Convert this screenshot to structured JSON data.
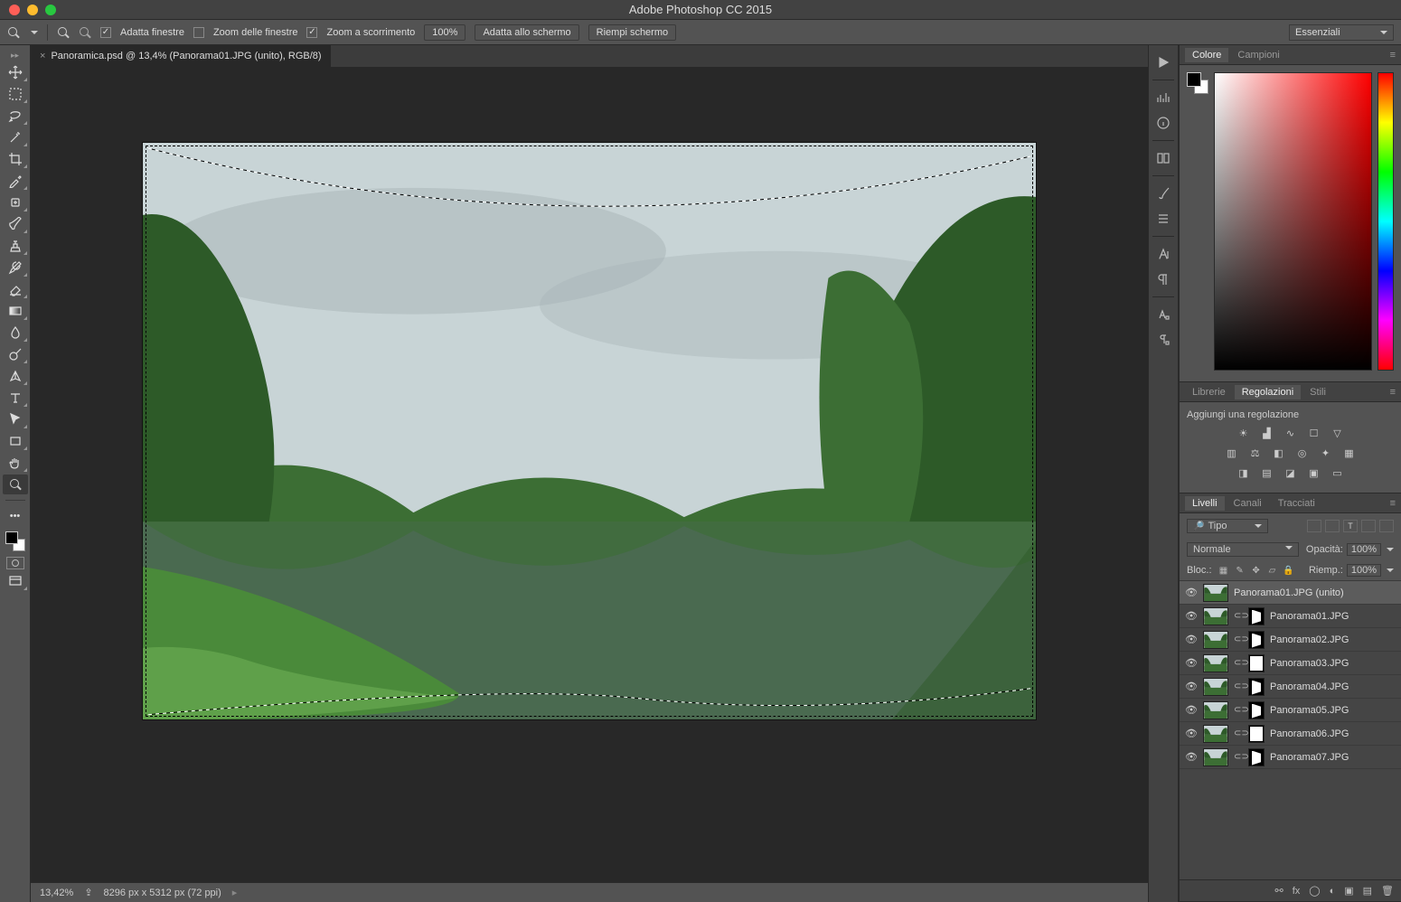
{
  "titlebar": {
    "app_title": "Adobe Photoshop CC 2015"
  },
  "optbar": {
    "fit_windows": "Adatta finestre",
    "zoom_windows": "Zoom delle finestre",
    "scroll_zoom": "Zoom a scorrimento",
    "zoom_pct": "100%",
    "fit_screen": "Adatta allo schermo",
    "fill_screen": "Riempi schermo",
    "workspace": "Essenziali"
  },
  "doc": {
    "tab_label": "Panoramica.psd @ 13,4% (Panorama01.JPG (unito), RGB/8)",
    "status_zoom": "13,42%",
    "status_dims": "8296 px x 5312 px (72 ppi)"
  },
  "panels": {
    "color_tab": "Colore",
    "swatches_tab": "Campioni",
    "libraries_tab": "Librerie",
    "adjustments_tab": "Regolazioni",
    "styles_tab": "Stili",
    "adjustments_hint": "Aggiungi una regolazione",
    "layers_tab": "Livelli",
    "channels_tab": "Canali",
    "paths_tab": "Tracciati"
  },
  "layers": {
    "filter_label": "Tipo",
    "blend_mode": "Normale",
    "opacity_label": "Opacità:",
    "opacity_value": "100%",
    "lock_label": "Bloc.:",
    "fill_label": "Riemp.:",
    "fill_value": "100%",
    "items": [
      {
        "name": "Panorama01.JPG (unito)",
        "mask": false,
        "selected": true
      },
      {
        "name": "Panorama01.JPG",
        "mask": true,
        "selected": false
      },
      {
        "name": "Panorama02.JPG",
        "mask": true,
        "selected": false
      },
      {
        "name": "Panorama03.JPG",
        "mask": true,
        "selected": false
      },
      {
        "name": "Panorama04.JPG",
        "mask": true,
        "selected": false
      },
      {
        "name": "Panorama05.JPG",
        "mask": true,
        "selected": false
      },
      {
        "name": "Panorama06.JPG",
        "mask": true,
        "selected": false
      },
      {
        "name": "Panorama07.JPG",
        "mask": true,
        "selected": false
      }
    ]
  }
}
